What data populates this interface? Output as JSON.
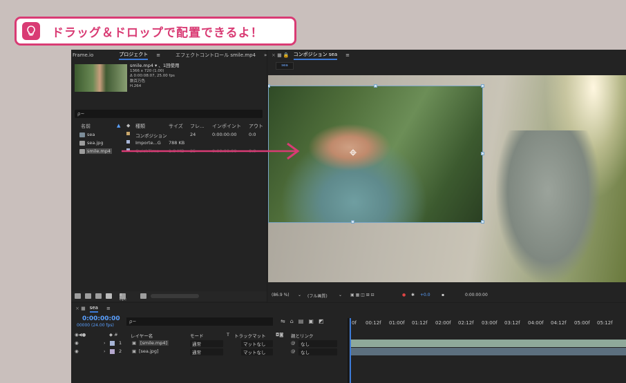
{
  "banner": {
    "text": "ドラッグ＆ドロップで配置できるよ！"
  },
  "project_panel": {
    "tabs": [
      "Frame.io",
      "プロジェクト",
      "≡",
      "エフェクトコントロール smile.mp4",
      "»"
    ],
    "selected_asset": {
      "name": "smile.mp4 ▾ 、1回使用",
      "line2": "1366 x 720 (1.00)",
      "line3": "Δ 0:00:08:07, 25.00 fps",
      "line4": "数百万色",
      "line5": "H.264"
    },
    "search_placeholder": "ρ~",
    "columns": [
      "名前",
      "種類",
      "サイズ",
      "フレ...",
      "インポイント",
      "アウト"
    ],
    "items": [
      {
        "name": "sea",
        "type": "コンポジション",
        "size": "",
        "frames": "24",
        "in": "0:00:00:00",
        "out": "0:0"
      },
      {
        "name": "sea.jpg",
        "type": "Importe...G",
        "size": "788 KB",
        "frames": "",
        "in": "",
        "out": ""
      },
      {
        "name": "smile.mp4",
        "type": "QuickTime",
        "size": "1.8 MB",
        "frames": "25",
        "in": "0:00:00:00",
        "out": "0:0"
      }
    ],
    "bpc": "8 bpc"
  },
  "comp_panel": {
    "tab": "コンポジション sea",
    "chip": "sea",
    "zoom": "(86.9 %)",
    "quality": "(フル画質)",
    "exposure": "+0.0",
    "timecode": "0:00:00:00"
  },
  "timeline": {
    "tab": "sea",
    "time": "0:00:00:00",
    "fps": "00000 (24.00 fps)",
    "search_placeholder": "ρ~",
    "columns": [
      "レイヤー名",
      "モード",
      "T",
      "トラックマット",
      "親とリンク"
    ],
    "layers": [
      {
        "num": "1",
        "name": "[smile.mp4]",
        "mode": "通常",
        "matte": "マットなし",
        "parent": "なし"
      },
      {
        "num": "2",
        "name": "[sea.jpg]",
        "mode": "通常",
        "matte": "マットなし",
        "parent": "なし"
      }
    ],
    "ruler": [
      "0f",
      "00:12f",
      "01:00f",
      "01:12f",
      "02:00f",
      "02:12f",
      "03:00f",
      "03:12f",
      "04:00f",
      "04:12f",
      "05:00f",
      "05:12f"
    ]
  },
  "colors": {
    "accent": "#d93b74",
    "highlight": "#3d7bd9"
  }
}
